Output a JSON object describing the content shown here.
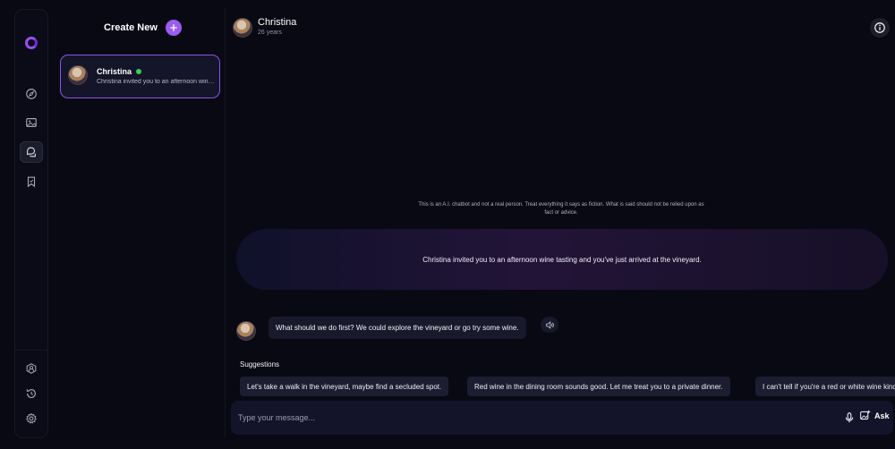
{
  "nav": {
    "items": [
      {
        "name": "explore",
        "active": false
      },
      {
        "name": "gallery",
        "active": false
      },
      {
        "name": "chats",
        "active": true
      },
      {
        "name": "saved",
        "active": false
      }
    ],
    "bottom_items": [
      "companion",
      "history",
      "settings"
    ]
  },
  "sidebar": {
    "create_label": "Create New",
    "chats": [
      {
        "name": "Christina",
        "online": true,
        "preview": "Christina invited you to an afternoon wine tasting and you've just arrived at the vineyard."
      }
    ]
  },
  "chat": {
    "name": "Christina",
    "age": "26 years",
    "disclaimer": "This is an A.I. chatbot and not a real person. Treat everything it says as fiction. What is said should not be relied upon as fact or advice.",
    "scene": "Christina invited you to an afternoon wine tasting and you've just arrived at the vineyard.",
    "messages": [
      {
        "from": "bot",
        "text": "What should we do first? We could explore the vineyard or go try some wine."
      }
    ],
    "suggestions_label": "Suggestions",
    "suggestions": [
      "Let's take a walk in the vineyard, maybe find a secluded spot.",
      "Red wine in the dining room sounds good. Let me treat you to a private dinner.",
      "I can't tell if you're a red or white wine kind of person."
    ],
    "composer": {
      "placeholder": "Type your message...",
      "value": "",
      "ask_label": "Ask"
    }
  },
  "colors": {
    "accent": "#9b5cf0",
    "online": "#34d058",
    "background": "#090914"
  }
}
